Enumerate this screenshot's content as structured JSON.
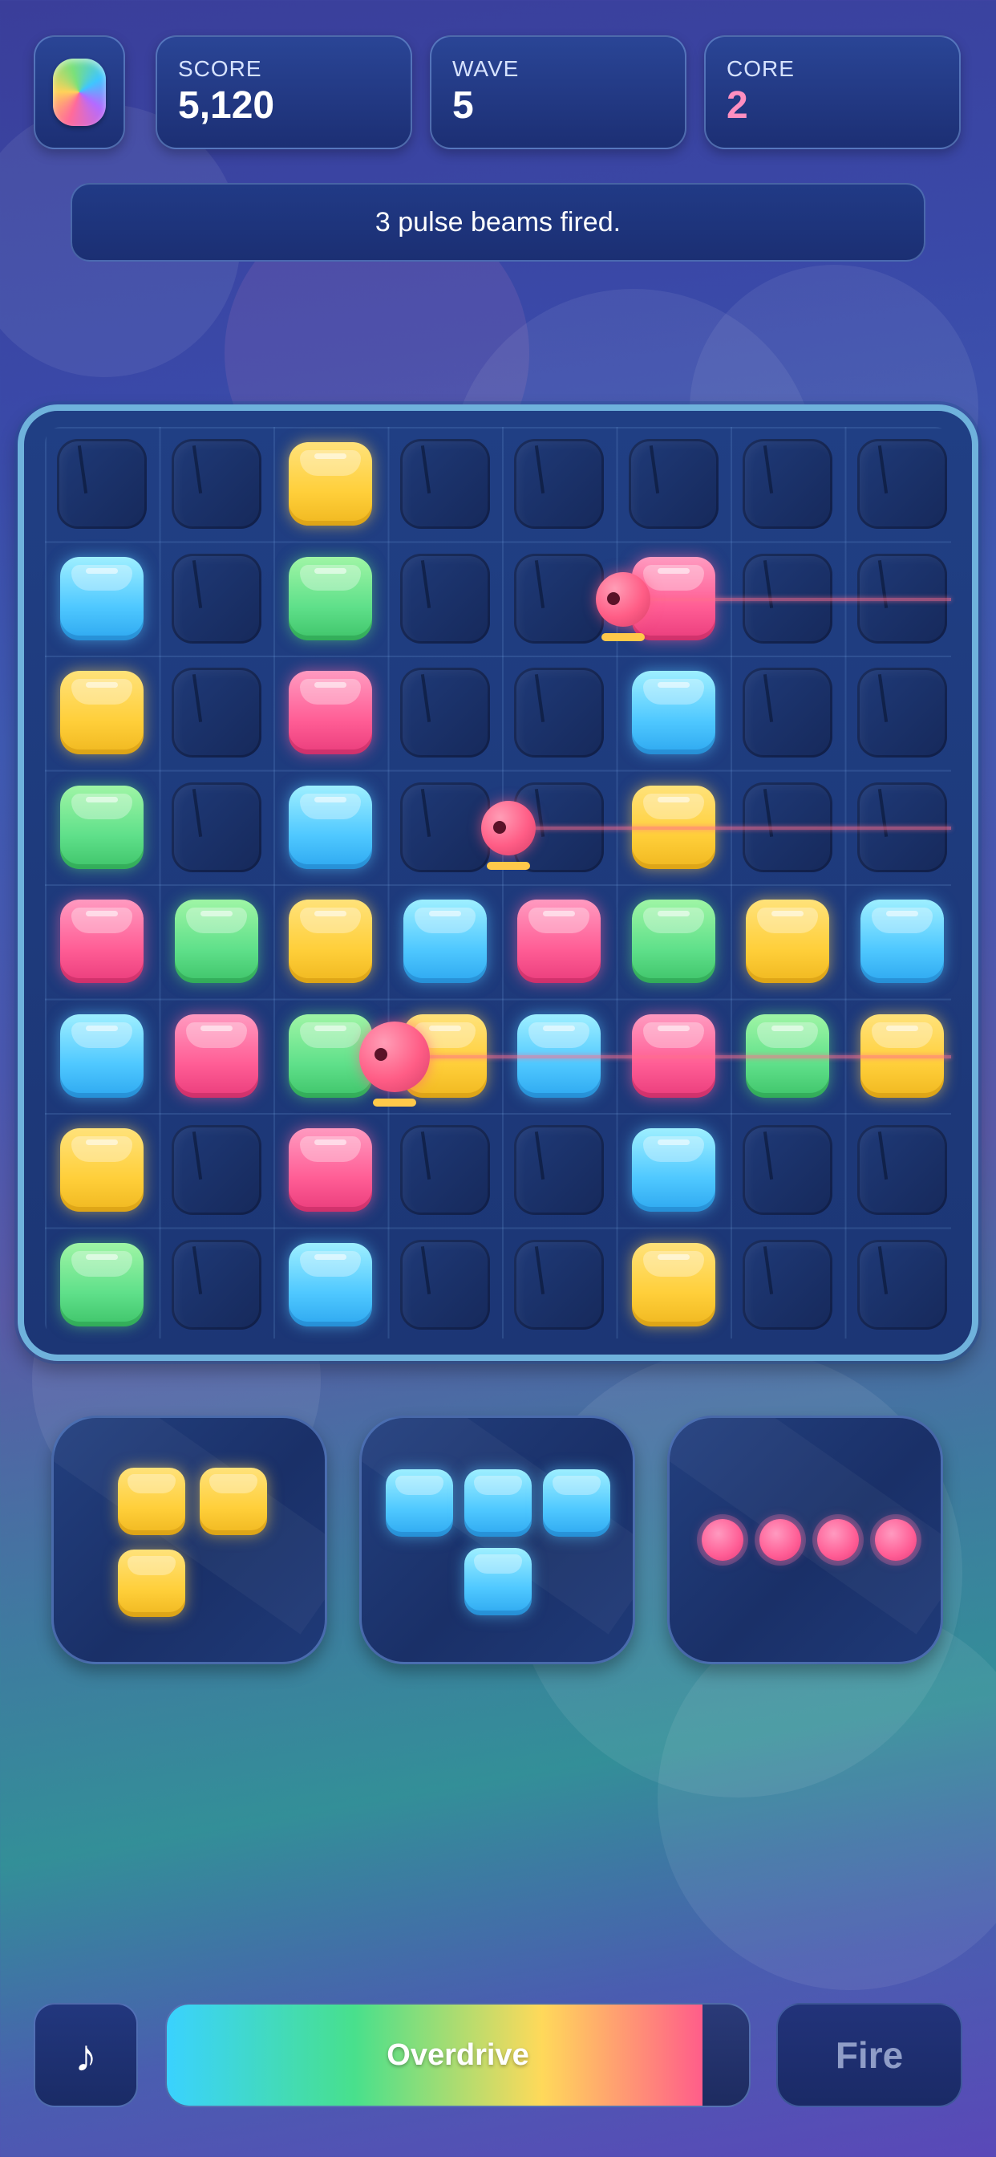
{
  "header": {
    "logo_icon": "rainbow-gem-icon",
    "score": {
      "label": "SCORE",
      "value": "5,120"
    },
    "wave": {
      "label": "WAVE",
      "value": "5"
    },
    "core": {
      "label": "CORE",
      "value": "2",
      "color": "#ff8fc0"
    }
  },
  "status_message": "3 pulse beams fired.",
  "board": {
    "rows": 8,
    "cols": 8,
    "grid": [
      [
        "empty",
        "empty",
        "yellow",
        "empty",
        "empty",
        "empty",
        "empty",
        "empty"
      ],
      [
        "blue",
        "empty",
        "green",
        "empty",
        "empty",
        "pink",
        "empty",
        "empty"
      ],
      [
        "yellow",
        "empty",
        "pink",
        "empty",
        "empty",
        "blue",
        "empty",
        "empty"
      ],
      [
        "green",
        "empty",
        "blue",
        "empty",
        "empty",
        "yellow",
        "empty",
        "empty"
      ],
      [
        "pink",
        "green",
        "yellow",
        "blue",
        "pink",
        "green",
        "yellow",
        "blue"
      ],
      [
        "blue",
        "pink",
        "green",
        "yellow",
        "blue",
        "pink",
        "green",
        "yellow"
      ],
      [
        "yellow",
        "empty",
        "pink",
        "empty",
        "empty",
        "blue",
        "empty",
        "empty"
      ],
      [
        "green",
        "empty",
        "blue",
        "empty",
        "empty",
        "yellow",
        "empty",
        "empty"
      ]
    ],
    "turrets": [
      {
        "row": 1,
        "col": 5,
        "beam": true
      },
      {
        "row": 3,
        "col": 4,
        "beam": true
      },
      {
        "row": 5,
        "col": 3,
        "beam": true
      }
    ]
  },
  "pieces": [
    {
      "name": "yellow-l-piece",
      "color": "yellow"
    },
    {
      "name": "blue-t-piece",
      "color": "blue"
    },
    {
      "name": "pink-line-piece",
      "color": "pink"
    }
  ],
  "controls": {
    "music_icon": "music-note-icon",
    "music_glyph": "♪",
    "overdrive_label": "Overdrive",
    "overdrive_level": 0.92,
    "fire_label": "Fire"
  },
  "colors": {
    "yellow": "#ffcf3a",
    "green": "#5fe08a",
    "pink": "#ff5d95",
    "blue": "#4fc8ff",
    "board_border": "#6fb2dc"
  }
}
